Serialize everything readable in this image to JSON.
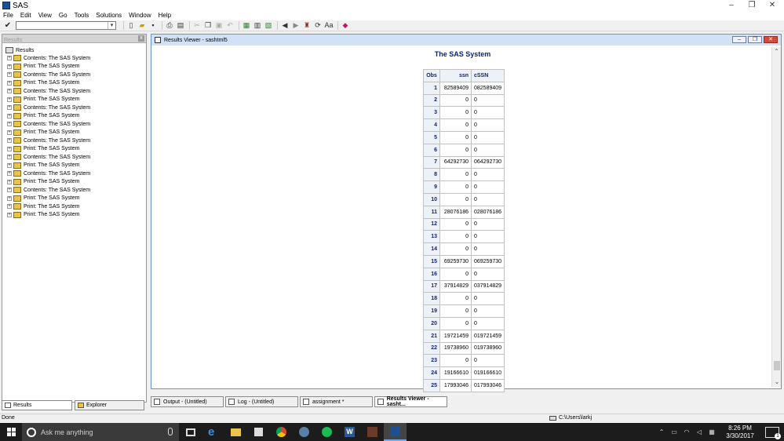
{
  "window": {
    "title": "SAS",
    "controls": {
      "minimize": "–",
      "maximize": "❐",
      "close": "✕"
    }
  },
  "menu": [
    "File",
    "Edit",
    "View",
    "Go",
    "Tools",
    "Solutions",
    "Window",
    "Help"
  ],
  "toolbar": {
    "command_value": ""
  },
  "left_pane": {
    "header": "Results",
    "root_label": "Results",
    "items": [
      "Contents:  The SAS System",
      "Print:  The SAS System",
      "Contents:  The SAS System",
      "Print:  The SAS System",
      "Contents:  The SAS System",
      "Print:  The SAS System",
      "Contents:  The SAS System",
      "Print:  The SAS System",
      "Contents:  The SAS System",
      "Print:  The SAS System",
      "Contents:  The SAS System",
      "Print:  The SAS System",
      "Contents:  The SAS System",
      "Print:  The SAS System",
      "Contents:  The SAS System",
      "Print:  The SAS System",
      "Contents:  The SAS System",
      "Print:  The SAS System",
      "Print:  The SAS System",
      "Print:  The SAS System"
    ],
    "tabs": [
      "Results",
      "Explorer"
    ]
  },
  "viewer": {
    "title": "Results Viewer - sashtml5",
    "report_title": "The SAS System",
    "columns": [
      "Obs",
      "ssn",
      "cSSN"
    ],
    "rows": [
      [
        "1",
        "82589409",
        "082589409"
      ],
      [
        "2",
        "0",
        "0"
      ],
      [
        "3",
        "0",
        "0"
      ],
      [
        "4",
        "0",
        "0"
      ],
      [
        "5",
        "0",
        "0"
      ],
      [
        "6",
        "0",
        "0"
      ],
      [
        "7",
        "64292730",
        "064292730"
      ],
      [
        "8",
        "0",
        "0"
      ],
      [
        "9",
        "0",
        "0"
      ],
      [
        "10",
        "0",
        "0"
      ],
      [
        "11",
        "28076186",
        "028076186"
      ],
      [
        "12",
        "0",
        "0"
      ],
      [
        "13",
        "0",
        "0"
      ],
      [
        "14",
        "0",
        "0"
      ],
      [
        "15",
        "69259730",
        "069259730"
      ],
      [
        "16",
        "0",
        "0"
      ],
      [
        "17",
        "37914829",
        "037914829"
      ],
      [
        "18",
        "0",
        "0"
      ],
      [
        "19",
        "0",
        "0"
      ],
      [
        "20",
        "0",
        "0"
      ],
      [
        "21",
        "19721459",
        "019721459"
      ],
      [
        "22",
        "19738960",
        "019738960"
      ],
      [
        "23",
        "0",
        "0"
      ],
      [
        "24",
        "19166610",
        "019166610"
      ],
      [
        "25",
        "17993046",
        "017993046"
      ]
    ]
  },
  "window_tabs": [
    "Output - (Untitled)",
    "Log - (Untitled)",
    "assignment *",
    "Results Viewer - sasht..."
  ],
  "status": {
    "text": "Done",
    "path": "C:\\Users\\larkj"
  },
  "taskbar": {
    "search_placeholder": "Ask me anything",
    "time": "8:26 PM",
    "date": "3/30/2017",
    "notification_count": "1"
  }
}
